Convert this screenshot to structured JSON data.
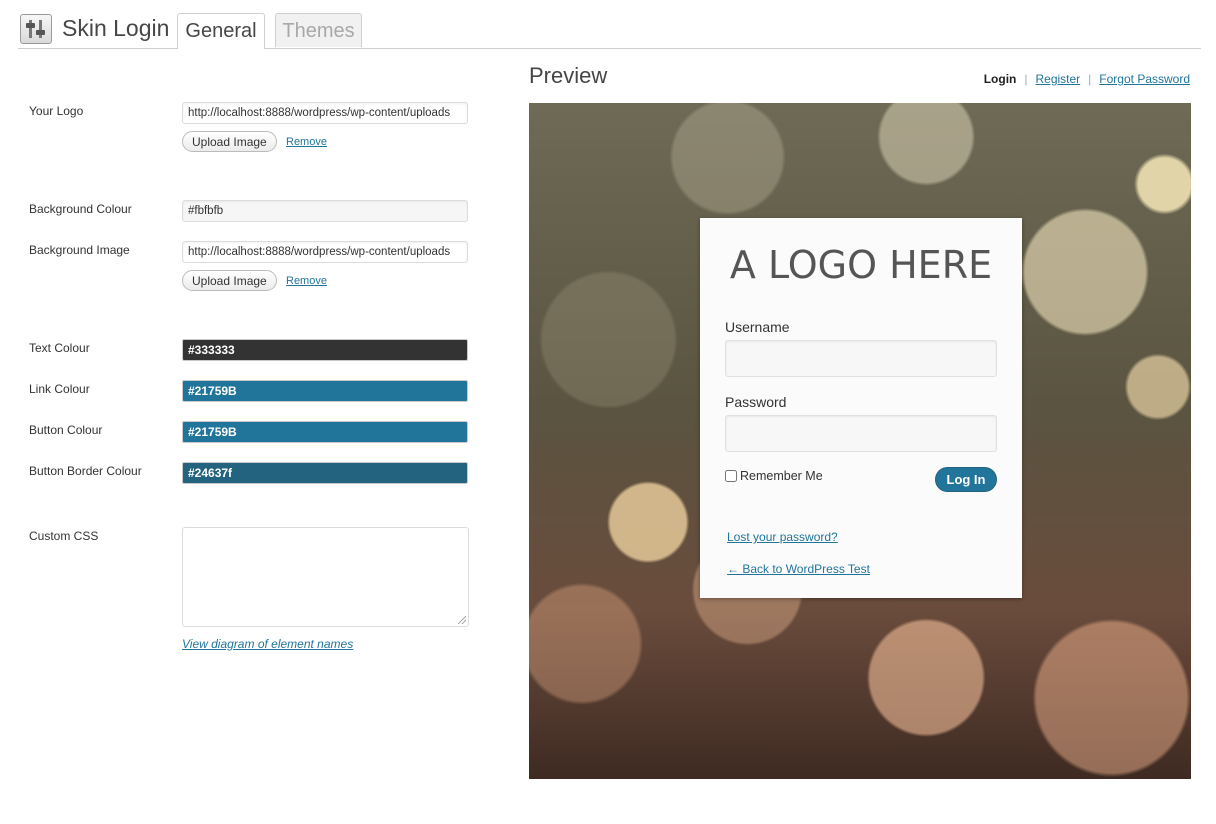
{
  "header": {
    "title": "Skin Login",
    "tabs": [
      {
        "label": "General",
        "active": true
      },
      {
        "label": "Themes",
        "active": false
      }
    ]
  },
  "settings": {
    "logo": {
      "label": "Your Logo",
      "value": "http://localhost:8888/wordpress/wp-content/uploads",
      "upload_label": "Upload Image",
      "remove_label": "Remove"
    },
    "background_colour": {
      "label": "Background Colour",
      "value": "#fbfbfb"
    },
    "background_image": {
      "label": "Background Image",
      "value": "http://localhost:8888/wordpress/wp-content/uploads",
      "upload_label": "Upload Image",
      "remove_label": "Remove"
    },
    "text_colour": {
      "label": "Text Colour",
      "value": "#333333",
      "swatch": "#333333"
    },
    "link_colour": {
      "label": "Link Colour",
      "value": "#21759B",
      "swatch": "#21759b"
    },
    "button_colour": {
      "label": "Button Colour",
      "value": "#21759B",
      "swatch": "#21759b"
    },
    "button_border_colour": {
      "label": "Button Border Colour",
      "value": "#24637f",
      "swatch": "#24637f"
    },
    "custom_css": {
      "label": "Custom CSS",
      "value": "",
      "diagram_link": "View diagram of element names"
    }
  },
  "preview": {
    "title": "Preview",
    "nav": {
      "login": "Login",
      "register": "Register",
      "forgot": "Forgot Password"
    },
    "login_box": {
      "logo_text": "A LOGO HERE",
      "username_label": "Username",
      "password_label": "Password",
      "remember_label": "Remember Me",
      "button_label": "Log In",
      "lost_password": "Lost your password?",
      "back_link": "← Back to WordPress Test"
    }
  },
  "icons": {
    "app": "settings-sliders-icon"
  },
  "colors": {
    "accent": "#21759b",
    "border_accent": "#24637f"
  }
}
